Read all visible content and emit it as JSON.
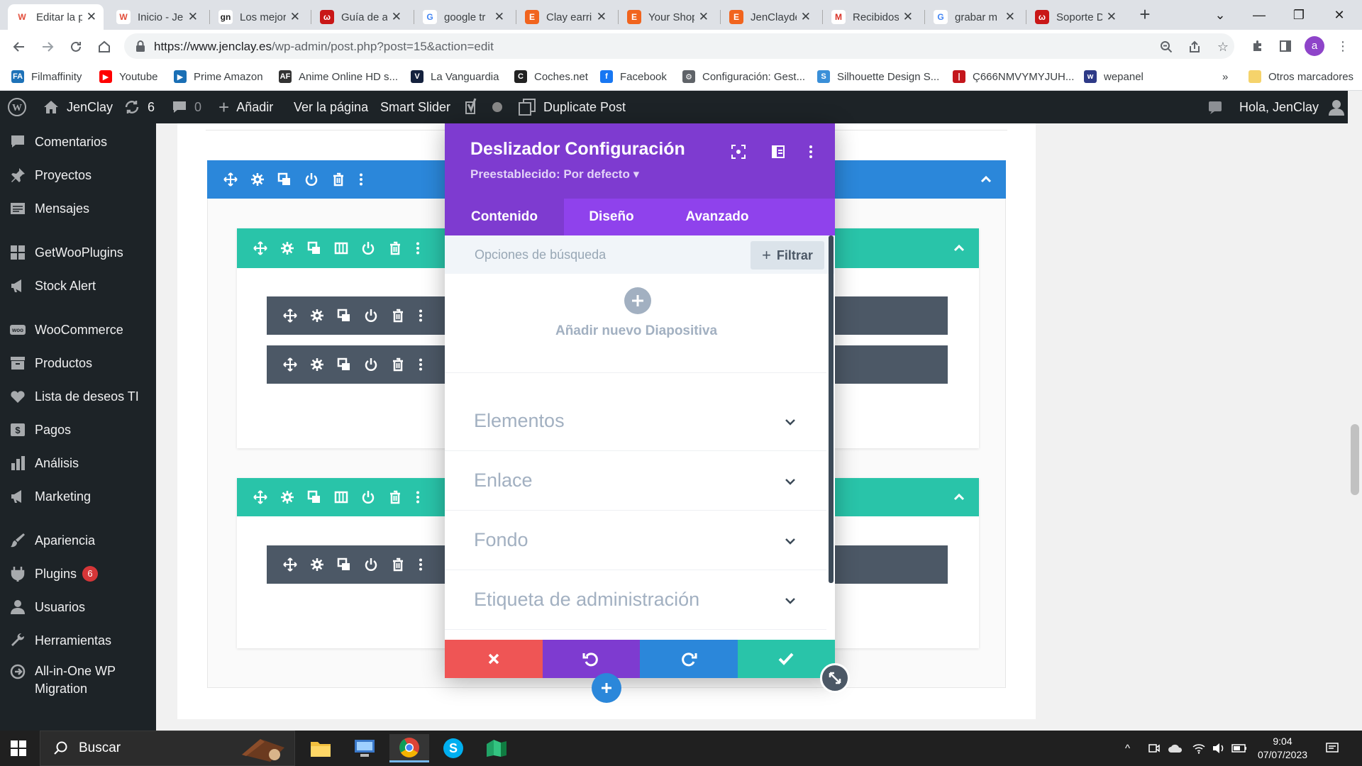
{
  "browser": {
    "tabs": [
      {
        "title": "Editar la p",
        "color": "#ffffff",
        "glyph": "W",
        "glyph_color": "#e24d3a",
        "active": true
      },
      {
        "title": "Inicio - Je",
        "color": "#ffffff",
        "glyph": "W",
        "glyph_color": "#e24d3a",
        "active": false
      },
      {
        "title": "Los mejor",
        "color": "#ffffff",
        "glyph": "gn",
        "glyph_color": "#222222",
        "active": false
      },
      {
        "title": "Guía de a",
        "color": "#c91717",
        "glyph": "ω",
        "glyph_color": "#ffffff",
        "active": false
      },
      {
        "title": "google tr",
        "color": "#ffffff",
        "glyph": "G",
        "glyph_color": "#4285f4",
        "active": false
      },
      {
        "title": "Clay earri",
        "color": "#f1641e",
        "glyph": "E",
        "glyph_color": "#ffffff",
        "active": false
      },
      {
        "title": "Your Shop",
        "color": "#f1641e",
        "glyph": "E",
        "glyph_color": "#ffffff",
        "active": false
      },
      {
        "title": "JenClayde",
        "color": "#f1641e",
        "glyph": "E",
        "glyph_color": "#ffffff",
        "active": false
      },
      {
        "title": "Recibidos",
        "color": "#ffffff",
        "glyph": "M",
        "glyph_color": "#d93025",
        "active": false
      },
      {
        "title": "grabar m",
        "color": "#ffffff",
        "glyph": "G",
        "glyph_color": "#4285f4",
        "active": false
      },
      {
        "title": "Soporte D",
        "color": "#c91717",
        "glyph": "ω",
        "glyph_color": "#ffffff",
        "active": false
      }
    ],
    "close_glyph": "✕",
    "new_tab": "+",
    "url_host": "https://www.jenclay.es",
    "url_path": "/wp-admin/post.php?post=15&action=edit",
    "avatar_letter": "a",
    "bookmarks": [
      {
        "label": "Filmaffinity",
        "color": "#1e72b8",
        "glyph": "FA"
      },
      {
        "label": "Youtube",
        "color": "#ff0000",
        "glyph": "▶"
      },
      {
        "label": "Prime Amazon",
        "color": "#1a6fb5",
        "glyph": "▶"
      },
      {
        "label": "Anime Online HD s...",
        "color": "#333333",
        "glyph": "AF"
      },
      {
        "label": "La Vanguardia",
        "color": "#14213d",
        "glyph": "V"
      },
      {
        "label": "Coches.net",
        "color": "#222222",
        "glyph": "C"
      },
      {
        "label": "Facebook",
        "color": "#1877f2",
        "glyph": "f"
      },
      {
        "label": "Configuración: Gest...",
        "color": "#5f6368",
        "glyph": "⚙"
      },
      {
        "label": "Silhouette Design S...",
        "color": "#3a8fd8",
        "glyph": "S"
      },
      {
        "label": "Ç666NMVYMYJUH...",
        "color": "#c4161c",
        "glyph": "|"
      },
      {
        "label": "wepanel",
        "color": "#2e3a87",
        "glyph": "w"
      }
    ],
    "more_bookmarks": "»",
    "other_bookmarks": "Otros marcadores"
  },
  "adminbar": {
    "site_name": "JenClay",
    "updates_count": "6",
    "comments_count": "0",
    "add_new": "Añadir",
    "view_page": "Ver la página",
    "smart_slider": "Smart Slider",
    "duplicate_post": "Duplicate Post",
    "greeting": "Hola, JenClay"
  },
  "sidebar": {
    "items": [
      {
        "label": "Comentarios",
        "icon": "comment-icon"
      },
      {
        "label": "Proyectos",
        "icon": "pin-icon"
      },
      {
        "label": "Mensajes",
        "icon": "message-icon"
      },
      {
        "label": "GetWooPlugins",
        "icon": "plugin-grid-icon"
      },
      {
        "label": "Stock Alert",
        "icon": "megaphone-icon"
      },
      {
        "label": "WooCommerce",
        "icon": "woo-icon"
      },
      {
        "label": "Productos",
        "icon": "archive-icon"
      },
      {
        "label": "Lista de deseos TI",
        "icon": "heart-icon"
      },
      {
        "label": "Pagos",
        "icon": "dollar-icon"
      },
      {
        "label": "Análisis",
        "icon": "bar-chart-icon"
      },
      {
        "label": "Marketing",
        "icon": "megaphone-icon"
      },
      {
        "label": "Apariencia",
        "icon": "brush-icon"
      },
      {
        "label": "Plugins",
        "icon": "plug-icon",
        "badge": "6"
      },
      {
        "label": "Usuarios",
        "icon": "user-icon"
      },
      {
        "label": "Herramientas",
        "icon": "wrench-icon"
      },
      {
        "label": "All-in-One WP",
        "label2": "Migration",
        "icon": "migration-icon"
      }
    ]
  },
  "modal": {
    "title": "Deslizador Configuración",
    "preset": "Preestablecido: Por defecto",
    "preset_caret": "▾",
    "tabs": [
      "Contenido",
      "Diseño",
      "Avanzado"
    ],
    "active_tab": "Contenido",
    "search_placeholder": "Opciones de búsqueda",
    "filter_label": "Filtrar",
    "add_slide_label": "Añadir nuevo Diapositiva",
    "accordion": [
      "Elementos",
      "Enlace",
      "Fondo",
      "Etiqueta de administración"
    ]
  },
  "colors": {
    "section": "#2b87da",
    "row": "#29c4a9",
    "module": "#4c5866",
    "modal_header": "#7e3bd0",
    "cancel": "#ef5555",
    "undo": "#7e3bd0",
    "redo": "#2b87da",
    "save": "#29c4a9"
  },
  "taskbar": {
    "search_label": "Buscar",
    "time": "9:04",
    "date": "07/07/2023"
  }
}
